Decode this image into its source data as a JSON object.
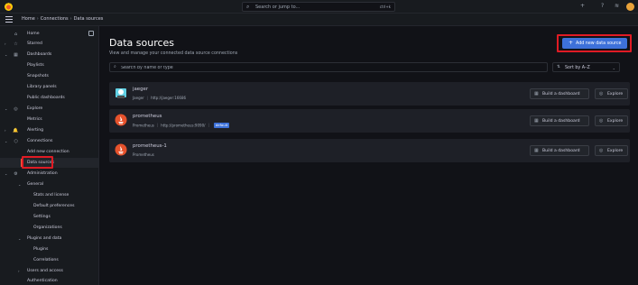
{
  "topbar": {
    "search_placeholder": "Search or jump to...",
    "search_shortcut": "ctrl+k",
    "plus_icon": "+",
    "help_icon": "?",
    "news_icon": "≋"
  },
  "breadcrumb": [
    "Home",
    "Connections",
    "Data sources"
  ],
  "sidebar": {
    "items": [
      {
        "label": "Home",
        "icon": "⌂"
      },
      {
        "label": "Starred",
        "icon": "☆"
      },
      {
        "label": "Dashboards",
        "icon": "▦"
      },
      {
        "label": "Playlists"
      },
      {
        "label": "Snapshots"
      },
      {
        "label": "Library panels"
      },
      {
        "label": "Public dashboards"
      },
      {
        "label": "Explore",
        "icon": "◎"
      },
      {
        "label": "Metrics"
      },
      {
        "label": "Alerting",
        "icon": "🔔"
      },
      {
        "label": "Connections",
        "icon": "⬡"
      },
      {
        "label": "Add new connection"
      },
      {
        "label": "Data sources"
      },
      {
        "label": "Administration",
        "icon": "⚙"
      },
      {
        "label": "General"
      },
      {
        "label": "Stats and license"
      },
      {
        "label": "Default preferences"
      },
      {
        "label": "Settings"
      },
      {
        "label": "Organizations"
      },
      {
        "label": "Plugins and data"
      },
      {
        "label": "Plugins"
      },
      {
        "label": "Correlations"
      },
      {
        "label": "Users and access"
      },
      {
        "label": "Authentication"
      }
    ]
  },
  "main": {
    "title": "Data sources",
    "subtitle": "View and manage your connected data source connections",
    "add_button": "Add new data source",
    "search_placeholder": "Search by name or type",
    "sort_label": "Sort by A–Z"
  },
  "datasources": [
    {
      "name": "jaeger",
      "type": "Jaeger",
      "url": "http://jaeger:16686",
      "default": ""
    },
    {
      "name": "prometheus",
      "type": "Prometheus",
      "url": "http://prometheus:9090/",
      "default": "default"
    },
    {
      "name": "prometheus-1",
      "type": "Prometheus",
      "url": "",
      "default": ""
    }
  ],
  "actions": {
    "build_dashboard": "Build a dashboard",
    "explore": "Explore"
  },
  "colors": {
    "accent": "#3d71d9",
    "highlight": "#e01b24",
    "prometheus": "#e6522c"
  }
}
